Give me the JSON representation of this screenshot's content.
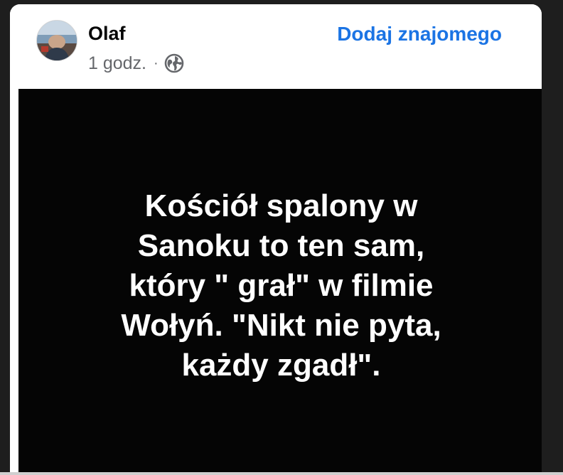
{
  "post": {
    "author": {
      "name": "Olaf",
      "avatar_icon": "profile-photo"
    },
    "timestamp": "1 godz.",
    "separator": "·",
    "privacy_icon": "globe-icon",
    "add_friend_label": "Dodaj znajomego",
    "image_text_lines": [
      "Kościół spalony w",
      "Sanoku to ten sam,",
      "który \" grał\" w filmie",
      "Wołyń. \"Nikt nie pyta,",
      "każdy zgadł\"."
    ]
  },
  "colors": {
    "link_blue": "#1b74e4",
    "image_background": "#050505",
    "image_text": "#ffffff",
    "secondary_text": "#65676b"
  }
}
